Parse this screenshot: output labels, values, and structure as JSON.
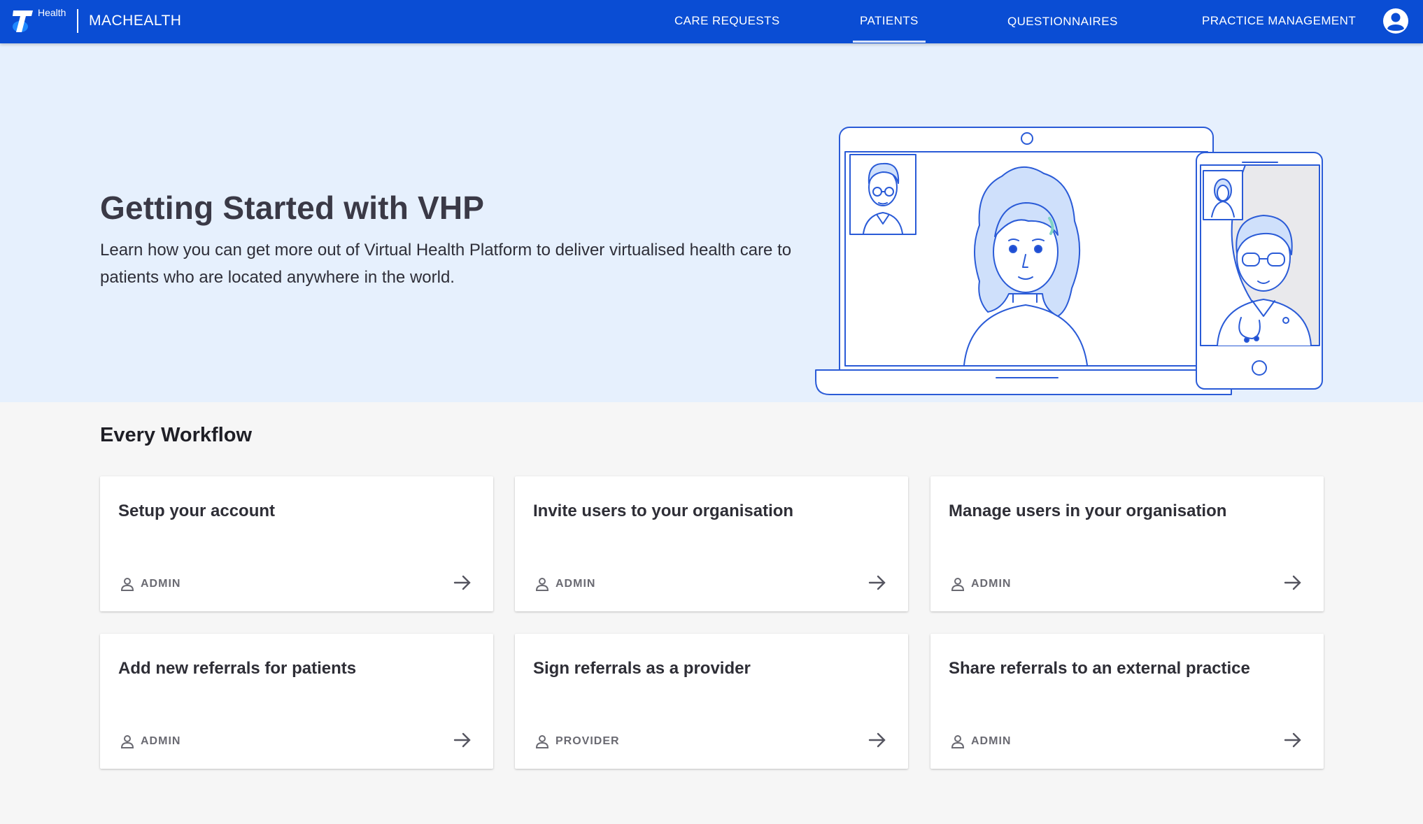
{
  "header": {
    "logo_subtext": "Health",
    "app_name": "MACHEALTH",
    "nav": [
      {
        "label": "CARE REQUESTS",
        "active": false
      },
      {
        "label": "PATIENTS",
        "active": true
      },
      {
        "label": "QUESTIONNAIRES",
        "active": false
      },
      {
        "label": "PRACTICE MANAGEMENT",
        "active": false
      }
    ],
    "account_icon": "user-circle-icon"
  },
  "hero": {
    "title": "Getting Started with VHP",
    "description": "Learn how you can get more out of Virtual Health Platform to deliver virtualised health care to patients who are located anywhere in the world."
  },
  "workflows": {
    "section_title": "Every Workflow",
    "cards": [
      {
        "title": "Setup your account",
        "role": "ADMIN"
      },
      {
        "title": "Invite users to your organisation",
        "role": "ADMIN"
      },
      {
        "title": "Manage users in your organisation",
        "role": "ADMIN"
      },
      {
        "title": "Add new referrals for patients",
        "role": "ADMIN"
      },
      {
        "title": "Sign referrals as a provider",
        "role": "PROVIDER"
      },
      {
        "title": "Share referrals to an external practice",
        "role": "ADMIN"
      }
    ]
  },
  "colors": {
    "brand_blue": "#0a4dd4",
    "hero_bg": "#e6f0fd",
    "page_bg": "#f6f6f6",
    "illustration_stroke": "#2a5bd7"
  }
}
